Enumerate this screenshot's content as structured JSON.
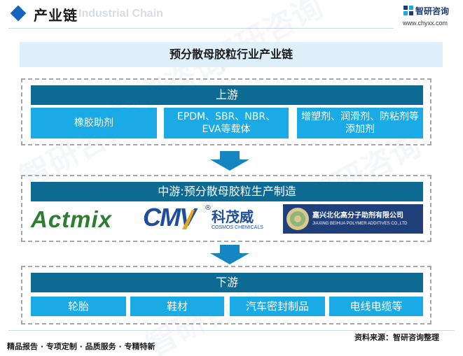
{
  "header": {
    "title": "产业链",
    "subtitle": "Industrial Chain"
  },
  "brand": {
    "name": "智研咨询",
    "url": "www.chyxx.com"
  },
  "watermark": "智研咨询",
  "main_title": "预分散母胶粒行业产业链",
  "upstream": {
    "label": "上游",
    "items": [
      "橡胶助剂",
      "EPDM、SBR、NBR、EVA等载体",
      "增塑剂、润滑剂、防粘剂等添加剂"
    ]
  },
  "midstream": {
    "label": "中游:预分散母胶粒生产制造",
    "companies": {
      "actmix": {
        "name": "Actmix"
      },
      "cmv": {
        "mark": "CMV",
        "registered": "®",
        "cn": "科茂威",
        "en": "COSMOS CHEMICALS"
      },
      "beihua": {
        "cn": "嘉兴北化高分子助剂有限公司",
        "en": "JIAXING BEIHUA POLYMER ADDITIVES CO.,LTD"
      }
    }
  },
  "downstream": {
    "label": "下游",
    "items": [
      "轮胎",
      "鞋材",
      "汽车密封制品",
      "电线电缆等"
    ]
  },
  "footer": {
    "tagline": "精品报告 · 专项定制 · 品质服务 · 专精特新",
    "source": "资料来源：智研咨询整理"
  },
  "colors": {
    "header_bar": "#0d6a92",
    "box": "#1aaae6",
    "title_bar": "#dff0fb",
    "arrow": "#1586c1",
    "actmix_green": "#2e7d32",
    "cmv_blue": "#1f4e9c",
    "cmv_gold": "#e6a817",
    "beihua_bg": "#1e3f7a"
  }
}
